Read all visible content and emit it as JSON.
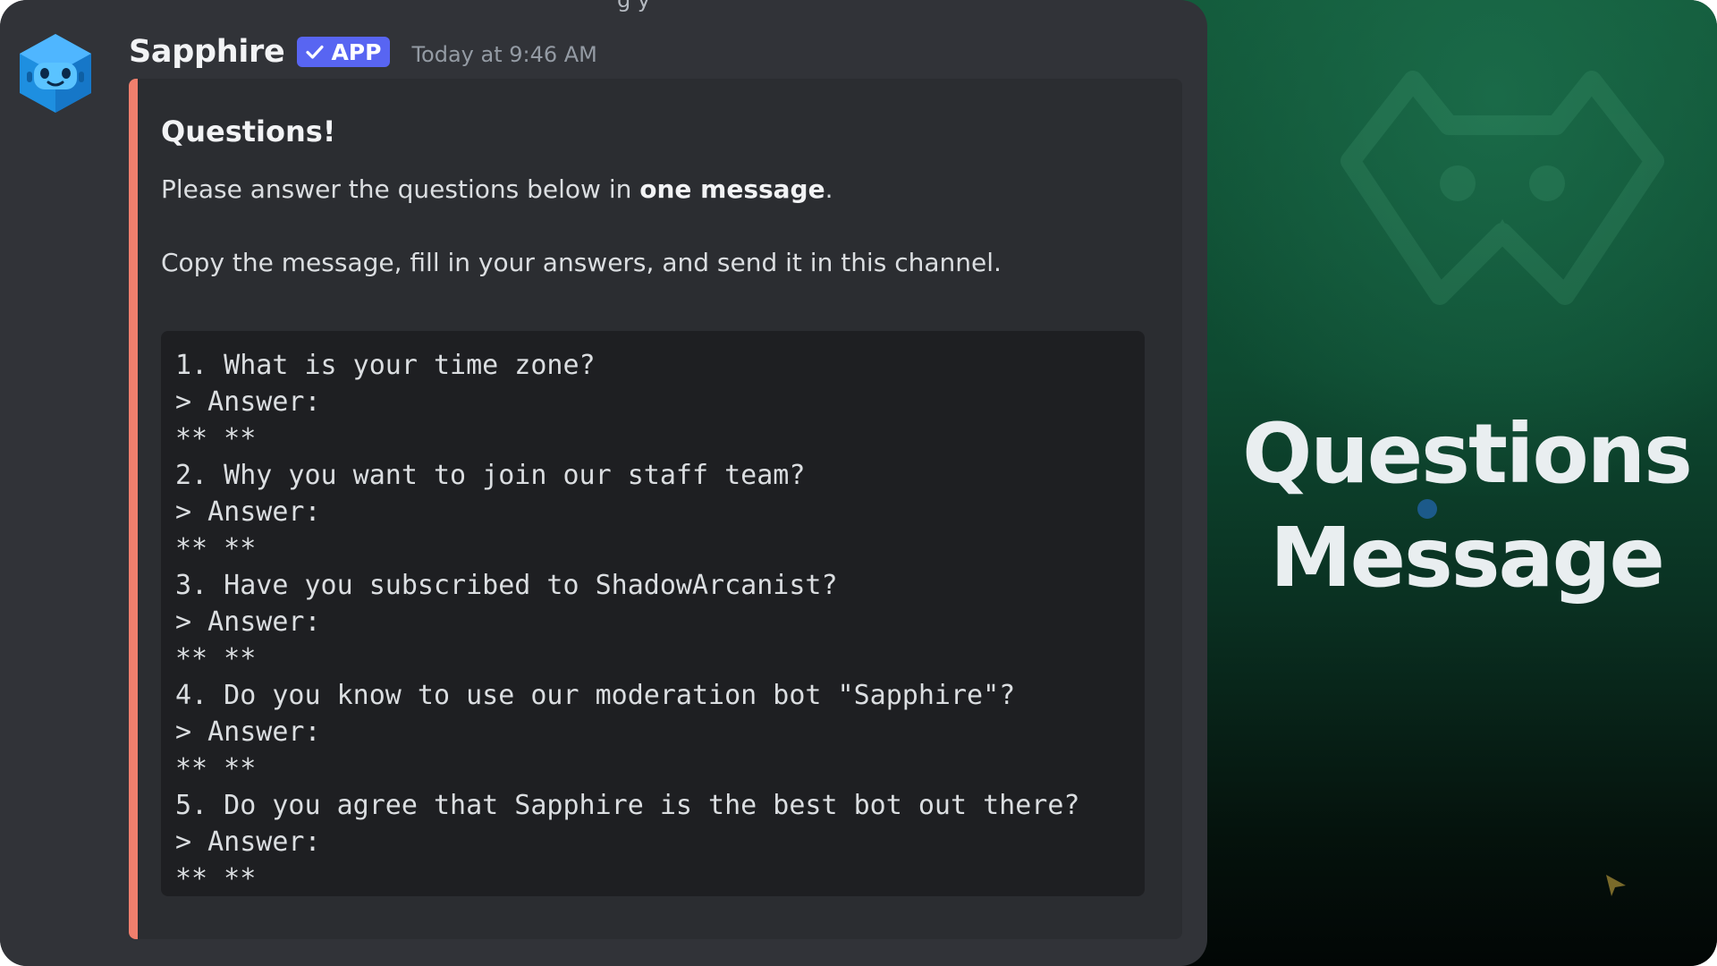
{
  "top_fragment": "g  y",
  "message": {
    "username": "Sapphire",
    "badge": "APP",
    "timestamp": "Today at 9:46 AM",
    "embed": {
      "accent_color": "#f07f6d",
      "title": "Questions!",
      "desc_line1_prefix": "Please answer the questions below in ",
      "desc_line1_bold": "one message",
      "desc_line1_suffix": ".",
      "desc_line2": "Copy the message, fill in your answers, and send it in this channel.",
      "code_lines": [
        "1. What is your time zone?",
        "> Answer:",
        "** **",
        "2. Why you want to join our staff team?",
        "> Answer:",
        "** **",
        "3. Have you subscribed to ShadowArcanist?",
        "> Answer:",
        "** **",
        "4. Do you know to use our moderation bot \"Sapphire\"?",
        "> Answer:",
        "** **",
        "5. Do you agree that Sapphire is the best bot out there?",
        "> Answer:",
        "** **"
      ]
    }
  },
  "promo": {
    "title_line1": "Questions",
    "title_line2": "Message"
  },
  "icons": [
    "sapphire-avatar-icon",
    "verified-check-icon",
    "sapphire-logo-watermark-icon",
    "cursor-arrow-icon"
  ],
  "colors": {
    "background": "#313338",
    "embed_bg": "#2b2d31",
    "code_bg": "#1e1f22",
    "badge": "#5865f2",
    "promo_green": "#135a3b"
  }
}
